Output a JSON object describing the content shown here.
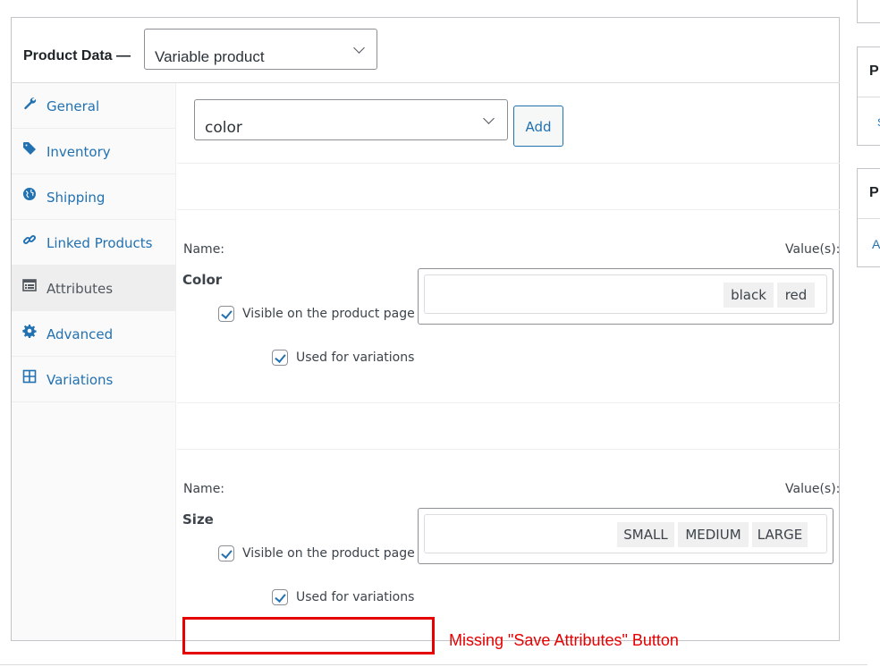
{
  "product_data": {
    "label": "Product Data —",
    "type_select_value": "Variable product"
  },
  "tabs": [
    {
      "label": "General",
      "icon": "wrench-icon"
    },
    {
      "label": "Inventory",
      "icon": "tag-icon"
    },
    {
      "label": "Shipping",
      "icon": "globe-icon"
    },
    {
      "label": "Linked Products",
      "icon": "link-icon"
    },
    {
      "label": "Attributes",
      "icon": "list-icon",
      "active": true
    },
    {
      "label": "Advanced",
      "icon": "gear-icon"
    },
    {
      "label": "Variations",
      "icon": "grid-icon"
    }
  ],
  "attributes": {
    "select_value": "color",
    "add_label": "Add",
    "items": [
      {
        "name_label": "Name:",
        "values_label": "Value(s):",
        "name": "Color",
        "values": [
          "black",
          "red"
        ],
        "visible_label": "Visible on the product page",
        "visible_checked": true,
        "variations_label": "Used for variations",
        "variations_checked": true
      },
      {
        "name_label": "Name:",
        "values_label": "Value(s):",
        "name": "Size",
        "values": [
          "SMALL",
          "MEDIUM",
          "LARGE"
        ],
        "visible_label": "Visible on the product page",
        "visible_checked": true,
        "variations_label": "Used for variations",
        "variations_checked": true
      }
    ]
  },
  "annotation": {
    "text": "Missing \"Save Attributes\" Button",
    "color": "#e60000"
  },
  "right_panels": [
    {
      "title": "P",
      "link": "S"
    },
    {
      "title": "P",
      "link": "A"
    }
  ],
  "colors": {
    "link": "#2271b1",
    "border": "#c3c4c7"
  }
}
